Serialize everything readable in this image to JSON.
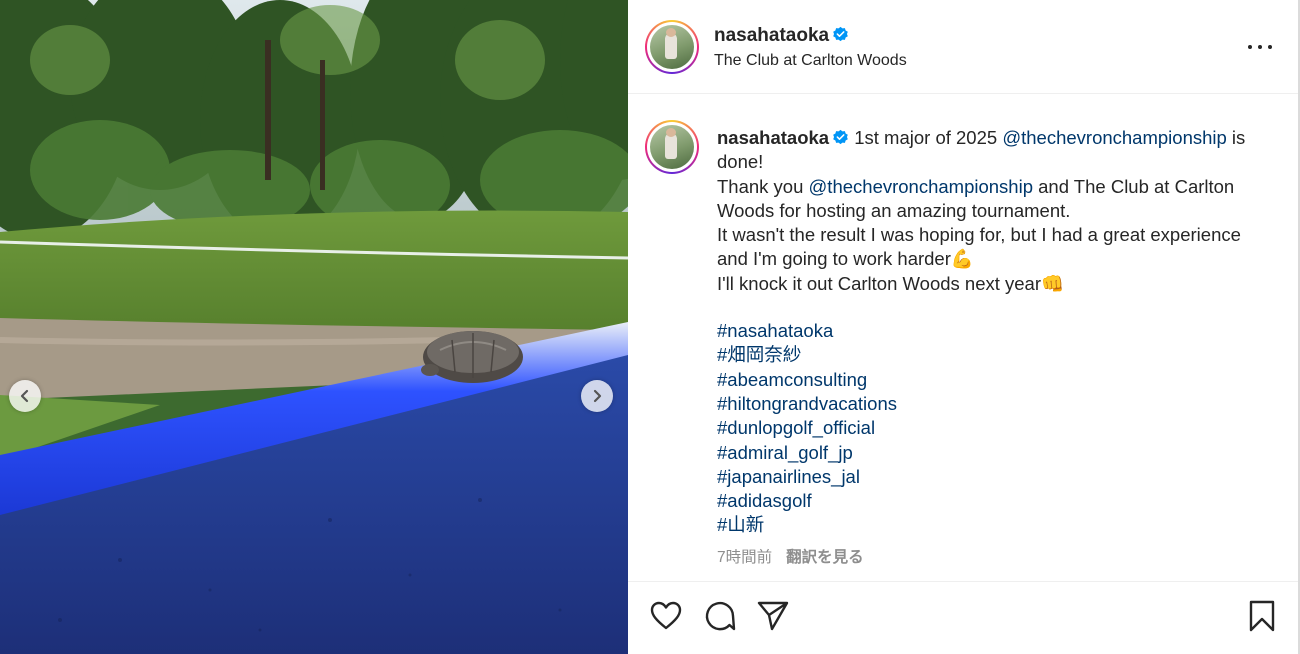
{
  "media": {
    "prev_icon": "chevron-left-icon",
    "next_icon": "chevron-right-icon"
  },
  "header": {
    "username": "nasahataoka",
    "location": "The Club at Carlton Woods",
    "more_icon": "more-horizontal-icon"
  },
  "caption": {
    "username": "nasahataoka",
    "line1_pre": " 1st major of 2025 ",
    "mention1": "@thechevronchampionship",
    "line1_post": " is done!",
    "line2_pre": "Thank you ",
    "mention2": "@thechevronchampionship",
    "line2_post": " and The Club at Carlton Woods for hosting an amazing tournament.",
    "line3": "It wasn't the result I was hoping for, but I had a great experience and I'm going to work harder💪",
    "line4": "I'll knock it out Carlton Woods next year👊",
    "hashtags": [
      "#nasahataoka",
      "#畑岡奈紗",
      "#abeamconsulting",
      "#hiltongrandvacations",
      "#dunlopgolf_official",
      "#admiral_golf_jp",
      "#japanairlines_jal",
      "#adidasgolf",
      "#山新"
    ]
  },
  "meta": {
    "time": "7時間前",
    "translate": "翻訳を見る"
  },
  "actions": {
    "like_icon": "heart-icon",
    "comment_icon": "comment-icon",
    "share_icon": "send-icon",
    "save_icon": "bookmark-icon"
  },
  "colors": {
    "link": "#00376b",
    "verified": "#0095f6",
    "text": "#262626",
    "muted": "#8e8e8e"
  }
}
